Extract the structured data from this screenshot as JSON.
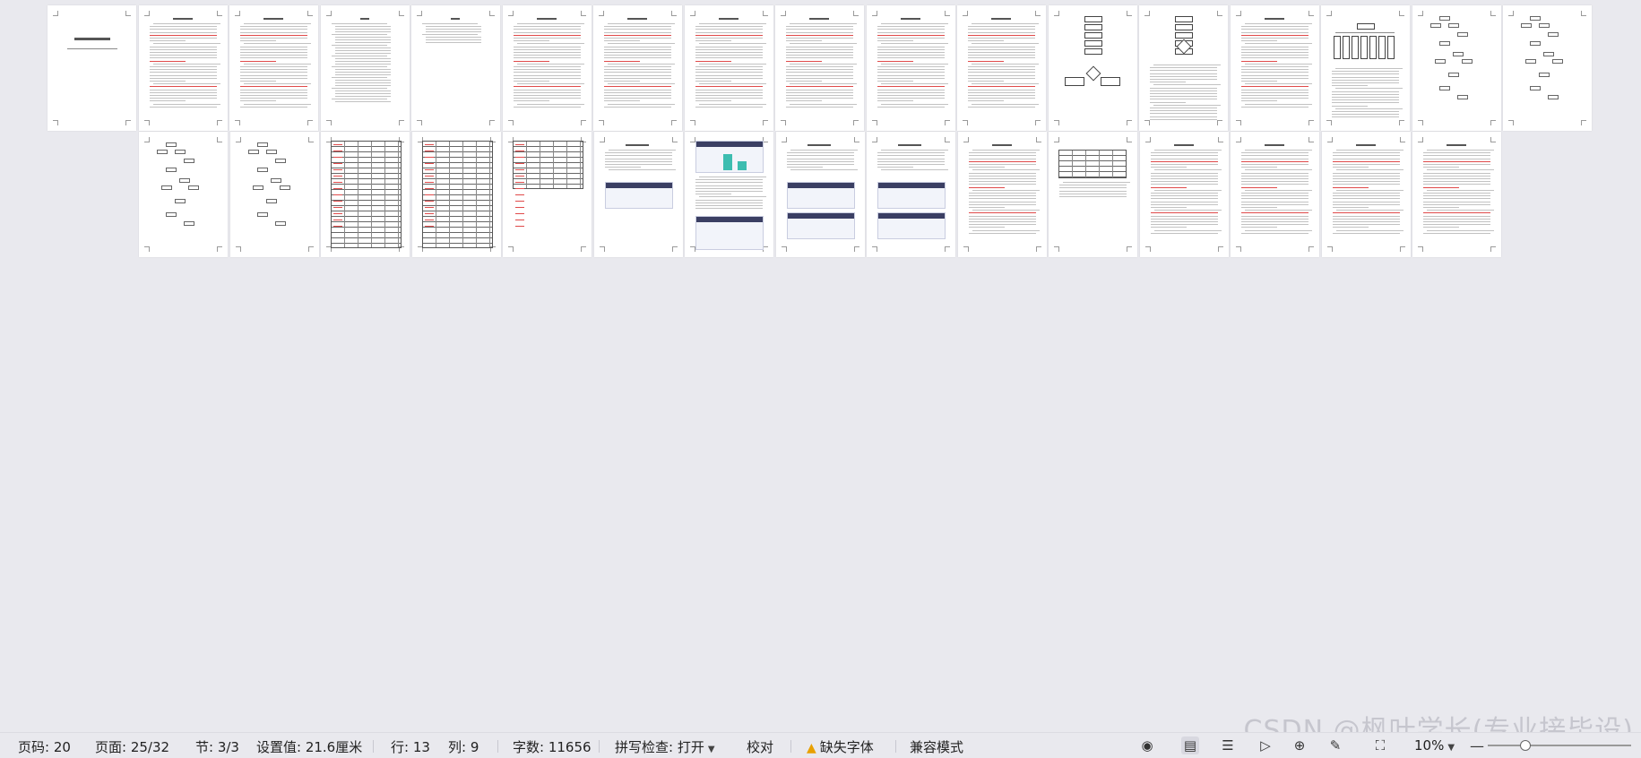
{
  "statusbar": {
    "page_code": "页码: 20",
    "pages": "页面: 25/32",
    "section": "节: 3/3",
    "setting": "设置值: 21.6厘米",
    "row": "行: 13",
    "col": "列: 9",
    "word_count": "字数: 11656",
    "spellcheck": "拼写检查: 打开",
    "proofread": "校对",
    "missing_fonts": "缺失字体",
    "compat_mode": "兼容模式",
    "zoom": "10%"
  },
  "watermark": "CSDN @枫叶学长(专业接毕设)",
  "icons": {
    "view_eye": "eye-icon",
    "page_view": "page-view-icon",
    "outline_view": "outline-icon",
    "play": "play-icon",
    "web_view": "globe-icon",
    "pen": "pen-icon",
    "fit": "fit-screen-icon"
  },
  "colors": {
    "accent_warning": "#e8a000",
    "spell_error": "#e04a4a",
    "chart_teal": "#3dbdb0"
  }
}
